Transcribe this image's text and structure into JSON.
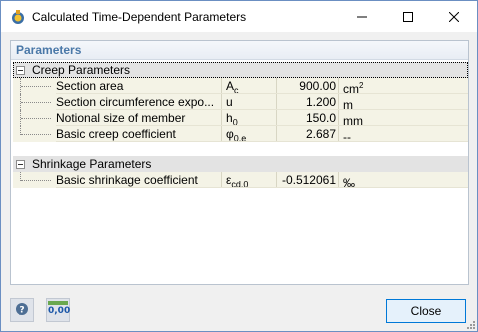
{
  "window": {
    "title": "Calculated Time-Dependent Parameters",
    "minimize_glyph": "–",
    "maximize_glyph": "☐",
    "close_glyph": "✕"
  },
  "panel": {
    "header": "Parameters",
    "groups": [
      {
        "label": "Creep Parameters",
        "expander": "minus",
        "rows": [
          {
            "description": "Section area",
            "symbol": "A",
            "symbol_sub": "c",
            "value": "900.00",
            "unit": "cm",
            "unit_sup": "2"
          },
          {
            "description": "Section circumference expo...",
            "symbol": "u",
            "symbol_sub": "",
            "value": "1.200",
            "unit": "m",
            "unit_sup": ""
          },
          {
            "description": "Notional size of member",
            "symbol": "h",
            "symbol_sub": "0",
            "value": "150.0",
            "unit": "mm",
            "unit_sup": ""
          },
          {
            "description": "Basic creep coefficient",
            "symbol": "φ",
            "symbol_sub": "0,e",
            "value": "2.687",
            "unit": "--",
            "unit_sup": ""
          }
        ]
      },
      {
        "label": "Shrinkage Parameters",
        "expander": "minus",
        "rows": [
          {
            "description": "Basic shrinkage coefficient",
            "symbol": "ε",
            "symbol_sub": "cd,0",
            "value": "-0.512061",
            "unit": "‰",
            "unit_sup": ""
          }
        ]
      }
    ]
  },
  "footer": {
    "help_icon": "help-icon",
    "units_icon_text": "0,00",
    "close_label": "Close"
  },
  "colors": {
    "header_text": "#4a78a8",
    "row_bg": "#f4f3e6",
    "group_bg": "#e3e3e3",
    "accent": "#0078d7"
  }
}
